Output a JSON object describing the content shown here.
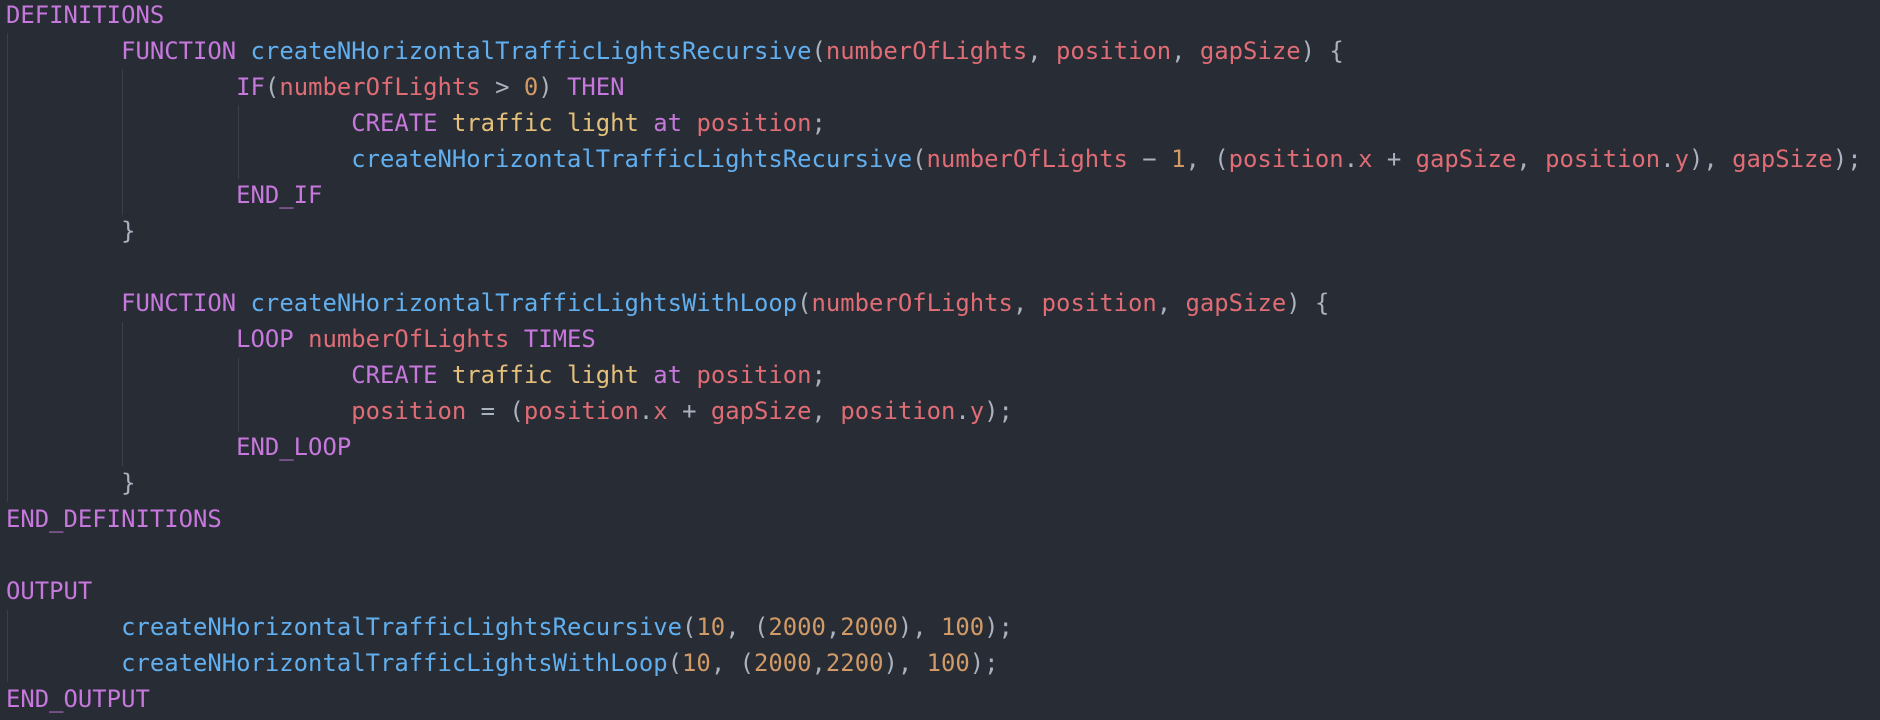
{
  "editor": {
    "theme_colors": {
      "background": "#282c34",
      "keyword": "#c678dd",
      "function": "#61afef",
      "variable": "#e06c75",
      "number": "#d19a66",
      "token": "#e5c07b",
      "punctuation": "#abb2bf",
      "indent_guide": "#3b4048"
    },
    "lines": [
      [
        {
          "t": "DEFINITIONS",
          "c": "kw"
        }
      ],
      [
        {
          "t": "        "
        },
        {
          "t": "FUNCTION",
          "c": "kw"
        },
        {
          "t": " "
        },
        {
          "t": "createNHorizontalTrafficLightsRecursive",
          "c": "fn"
        },
        {
          "t": "(",
          "c": "op"
        },
        {
          "t": "numberOfLights",
          "c": "var"
        },
        {
          "t": ", ",
          "c": "op"
        },
        {
          "t": "position",
          "c": "var"
        },
        {
          "t": ", ",
          "c": "op"
        },
        {
          "t": "gapSize",
          "c": "var"
        },
        {
          "t": ") {",
          "c": "op"
        }
      ],
      [
        {
          "t": "                "
        },
        {
          "t": "IF",
          "c": "kw"
        },
        {
          "t": "(",
          "c": "op"
        },
        {
          "t": "numberOfLights",
          "c": "var"
        },
        {
          "t": " > ",
          "c": "op"
        },
        {
          "t": "0",
          "c": "num"
        },
        {
          "t": ") ",
          "c": "op"
        },
        {
          "t": "THEN",
          "c": "kw"
        }
      ],
      [
        {
          "t": "                        "
        },
        {
          "t": "CREATE",
          "c": "kw"
        },
        {
          "t": " "
        },
        {
          "t": "traffic",
          "c": "tok"
        },
        {
          "t": " "
        },
        {
          "t": "light",
          "c": "tok"
        },
        {
          "t": " "
        },
        {
          "t": "at",
          "c": "kw"
        },
        {
          "t": " "
        },
        {
          "t": "position",
          "c": "var"
        },
        {
          "t": ";",
          "c": "op"
        }
      ],
      [
        {
          "t": "                        "
        },
        {
          "t": "createNHorizontalTrafficLightsRecursive",
          "c": "fn"
        },
        {
          "t": "(",
          "c": "op"
        },
        {
          "t": "numberOfLights",
          "c": "var"
        },
        {
          "t": " − ",
          "c": "op"
        },
        {
          "t": "1",
          "c": "num"
        },
        {
          "t": ", (",
          "c": "op"
        },
        {
          "t": "position",
          "c": "var"
        },
        {
          "t": ".",
          "c": "op"
        },
        {
          "t": "x",
          "c": "var"
        },
        {
          "t": " + ",
          "c": "op"
        },
        {
          "t": "gapSize",
          "c": "var"
        },
        {
          "t": ", ",
          "c": "op"
        },
        {
          "t": "position",
          "c": "var"
        },
        {
          "t": ".",
          "c": "op"
        },
        {
          "t": "y",
          "c": "var"
        },
        {
          "t": "), ",
          "c": "op"
        },
        {
          "t": "gapSize",
          "c": "var"
        },
        {
          "t": ");",
          "c": "op"
        }
      ],
      [
        {
          "t": "                "
        },
        {
          "t": "END_IF",
          "c": "kw"
        }
      ],
      [
        {
          "t": "        "
        },
        {
          "t": "}",
          "c": "op"
        }
      ],
      [],
      [
        {
          "t": "        "
        },
        {
          "t": "FUNCTION",
          "c": "kw"
        },
        {
          "t": " "
        },
        {
          "t": "createNHorizontalTrafficLightsWithLoop",
          "c": "fn"
        },
        {
          "t": "(",
          "c": "op"
        },
        {
          "t": "numberOfLights",
          "c": "var"
        },
        {
          "t": ", ",
          "c": "op"
        },
        {
          "t": "position",
          "c": "var"
        },
        {
          "t": ", ",
          "c": "op"
        },
        {
          "t": "gapSize",
          "c": "var"
        },
        {
          "t": ") {",
          "c": "op"
        }
      ],
      [
        {
          "t": "                "
        },
        {
          "t": "LOOP",
          "c": "kw"
        },
        {
          "t": " "
        },
        {
          "t": "numberOfLights",
          "c": "var"
        },
        {
          "t": " "
        },
        {
          "t": "TIMES",
          "c": "kw"
        }
      ],
      [
        {
          "t": "                        "
        },
        {
          "t": "CREATE",
          "c": "kw"
        },
        {
          "t": " "
        },
        {
          "t": "traffic",
          "c": "tok"
        },
        {
          "t": " "
        },
        {
          "t": "light",
          "c": "tok"
        },
        {
          "t": " "
        },
        {
          "t": "at",
          "c": "kw"
        },
        {
          "t": " "
        },
        {
          "t": "position",
          "c": "var"
        },
        {
          "t": ";",
          "c": "op"
        }
      ],
      [
        {
          "t": "                        "
        },
        {
          "t": "position",
          "c": "var"
        },
        {
          "t": " = (",
          "c": "op"
        },
        {
          "t": "position",
          "c": "var"
        },
        {
          "t": ".",
          "c": "op"
        },
        {
          "t": "x",
          "c": "var"
        },
        {
          "t": " + ",
          "c": "op"
        },
        {
          "t": "gapSize",
          "c": "var"
        },
        {
          "t": ", ",
          "c": "op"
        },
        {
          "t": "position",
          "c": "var"
        },
        {
          "t": ".",
          "c": "op"
        },
        {
          "t": "y",
          "c": "var"
        },
        {
          "t": ");",
          "c": "op"
        }
      ],
      [
        {
          "t": "                "
        },
        {
          "t": "END_LOOP",
          "c": "kw"
        }
      ],
      [
        {
          "t": "        "
        },
        {
          "t": "}",
          "c": "op"
        }
      ],
      [
        {
          "t": "END_DEFINITIONS",
          "c": "kw"
        }
      ],
      [],
      [
        {
          "t": "OUTPUT",
          "c": "kw"
        }
      ],
      [
        {
          "t": "        "
        },
        {
          "t": "createNHorizontalTrafficLightsRecursive",
          "c": "fn"
        },
        {
          "t": "(",
          "c": "op"
        },
        {
          "t": "10",
          "c": "num"
        },
        {
          "t": ", (",
          "c": "op"
        },
        {
          "t": "2000",
          "c": "num"
        },
        {
          "t": ",",
          "c": "op"
        },
        {
          "t": "2000",
          "c": "num"
        },
        {
          "t": "), ",
          "c": "op"
        },
        {
          "t": "100",
          "c": "num"
        },
        {
          "t": ");",
          "c": "op"
        }
      ],
      [
        {
          "t": "        "
        },
        {
          "t": "createNHorizontalTrafficLightsWithLoop",
          "c": "fn"
        },
        {
          "t": "(",
          "c": "op"
        },
        {
          "t": "10",
          "c": "num"
        },
        {
          "t": ", (",
          "c": "op"
        },
        {
          "t": "2000",
          "c": "num"
        },
        {
          "t": ",",
          "c": "op"
        },
        {
          "t": "2200",
          "c": "num"
        },
        {
          "t": "), ",
          "c": "op"
        },
        {
          "t": "100",
          "c": "num"
        },
        {
          "t": ");",
          "c": "op"
        }
      ],
      [
        {
          "t": "END_OUTPUT",
          "c": "kw"
        }
      ]
    ]
  }
}
